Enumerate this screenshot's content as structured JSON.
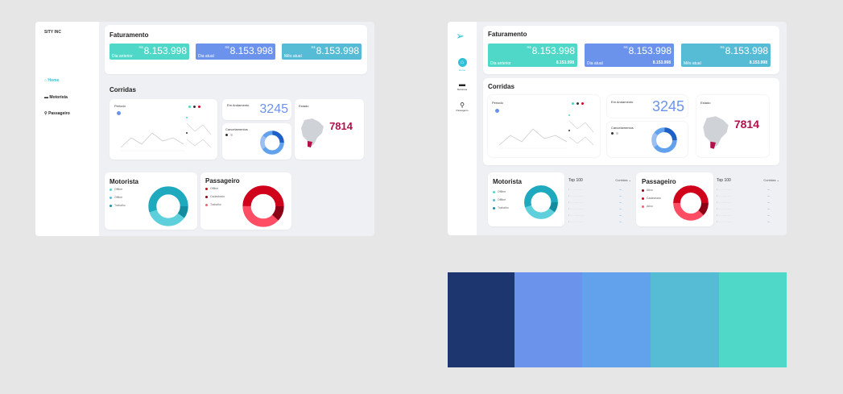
{
  "colors": {
    "navy": "#1e3670",
    "blue": "#6b93ec",
    "sky": "#62a1ec",
    "teal": "#56bcd6",
    "aqua": "#4fd8c8",
    "red": "#d0021b",
    "crimson": "#b3104a"
  },
  "left": {
    "brand": "SITY INC",
    "nav": [
      {
        "icon": "home-icon",
        "label": "Home"
      },
      {
        "icon": "car-icon",
        "label": "Motorista"
      },
      {
        "icon": "walk-icon",
        "label": "Passageiro"
      }
    ],
    "faturamento": {
      "title": "Faturamento",
      "cards": [
        {
          "symbol": "R$",
          "value": "8.153.998",
          "label": "Dia anterior"
        },
        {
          "symbol": "R$",
          "value": "8.153.998",
          "label": "Dia atual"
        },
        {
          "symbol": "R$",
          "value": "8.153.998",
          "label": "Mês atual"
        }
      ]
    },
    "corridas": {
      "title": "Corridas",
      "periodo_label": "Periodo",
      "em_andamento_label": "Em Andamento",
      "em_andamento_value": "3245",
      "cancelamentos_label": "Cancelamentos",
      "estado_label": "Estado",
      "estado_value": "7814"
    },
    "motorista": {
      "title": "Motorista",
      "legend": [
        "Offline",
        "Offline",
        "Trabalho"
      ]
    },
    "passageiro": {
      "title": "Passageiro",
      "legend": [
        "Offline",
        "Cadastrado",
        "Trabalho"
      ]
    }
  },
  "right": {
    "nav": [
      {
        "icon": "home-icon",
        "label": "Home"
      },
      {
        "icon": "car-icon",
        "label": "Motorista"
      },
      {
        "icon": "walk-icon",
        "label": "Passageiro"
      }
    ],
    "faturamento": {
      "title": "Faturamento",
      "cards": [
        {
          "symbol": "R$",
          "value": "8.153.998",
          "label": "Dia anterior",
          "small": "8.153.998"
        },
        {
          "symbol": "R$",
          "value": "8.153.998",
          "label": "Dia atual",
          "small": "8.153.998"
        },
        {
          "symbol": "R$",
          "value": "8.153.998",
          "label": "Mês atual",
          "small": "8.153.998"
        }
      ]
    },
    "corridas": {
      "title": "Corridas",
      "periodo_label": "Periodo",
      "em_andamento_label": "Em Andamento",
      "em_andamento_value": "3245",
      "cancelamentos_label": "Cancelamentos",
      "estado_label": "Estado",
      "estado_value": "7814"
    },
    "motorista": {
      "title": "Motorista",
      "legend": [
        "Offline",
        "Offline",
        "Trabalho"
      ],
      "top_title": "Top 100",
      "top_filter": "Corridas"
    },
    "passageiro": {
      "title": "Passageiro",
      "legend": [
        "Ativo",
        "Cadastrado",
        "Ativo"
      ],
      "top_title": "Top 100",
      "top_filter": "Corridas"
    }
  },
  "palette": [
    "#1e3670",
    "#6b93ec",
    "#62a1ec",
    "#56bcd6",
    "#4fd8c8"
  ]
}
